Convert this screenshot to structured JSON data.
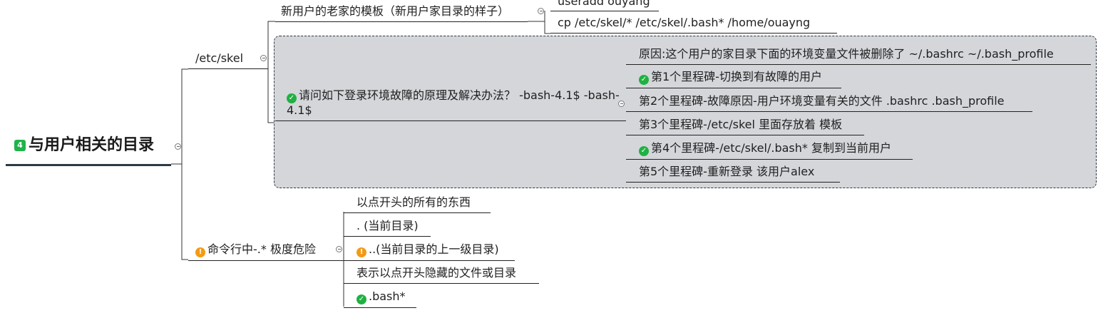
{
  "root": {
    "badge": "4",
    "label": "与用户相关的目录"
  },
  "skel": {
    "label": "/etc/skel",
    "template": {
      "label": "新用户的老家的模板（新用户家目录的样子）",
      "children": [
        "useradd ouyang",
        "cp /etc/skel/* /etc/skel/.bash*   /home/ouayng"
      ]
    },
    "question": {
      "label": "请问如下登录环境故障的原理及解决办法？  -bash-4.1$  -bash-4.1$",
      "children": [
        {
          "label": "原因:这个用户的家目录下面的环境变量文件被删除了  ~/.bashrc  ~/.bash_profile",
          "icon": ""
        },
        {
          "label": "第1个里程碑-切换到有故障的用户",
          "icon": "check-icon"
        },
        {
          "label": "第2个里程碑-故障原因-用户环境变量有关的文件 .bashrc .bash_profile",
          "icon": ""
        },
        {
          "label": "第3个里程碑-/etc/skel 里面存放着  模板",
          "icon": ""
        },
        {
          "label": "第4个里程碑-/etc/skel/.bash* 复制到当前用户",
          "icon": "check-icon"
        },
        {
          "label": "第5个里程碑-重新登录  该用户alex",
          "icon": ""
        }
      ]
    }
  },
  "danger": {
    "label": "命令行中-.* 极度危险",
    "children": [
      {
        "label": "以点开头的所有的东西",
        "icon": ""
      },
      {
        "label": ". (当前目录)",
        "icon": ""
      },
      {
        "label": "..(当前目录的上一级目录)",
        "icon": "warning-icon"
      },
      {
        "label": "表示以点开头隐藏的文件或目录",
        "icon": ""
      },
      {
        "label": ".bash*",
        "icon": "check-icon"
      }
    ]
  },
  "colors": {
    "check": "#1fb141",
    "warning": "#f39a16",
    "badge": "#20b34b",
    "group_bg": "#d4d6da"
  }
}
